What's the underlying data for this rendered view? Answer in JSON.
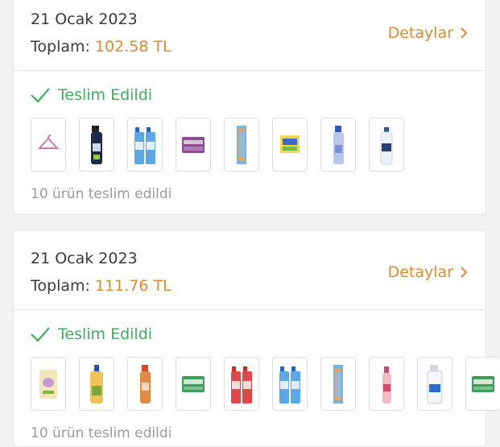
{
  "orders": [
    {
      "date": "21 Ocak 2023",
      "total_label": "Toplam:",
      "total_value": "102.58 TL",
      "details_label": "Detaylar",
      "status": "Teslim Edildi",
      "delivered_text": "10 ürün teslim edildi",
      "products": [
        "hanger-icon",
        "spray-dark-icon",
        "spray-double-blue-icon",
        "soap-pack-icon",
        "cloth-pack-icon",
        "sponge-pack-icon",
        "spray-lavender-icon",
        "bottle-white-icon"
      ]
    },
    {
      "date": "21 Ocak 2023",
      "total_label": "Toplam:",
      "total_value": "111.76 TL",
      "details_label": "Detaylar",
      "status": "Teslim Edildi",
      "delivered_text": "10 ürün teslim edildi",
      "products": [
        "wipes-pack-icon",
        "bottle-yellow-icon",
        "spray-orange-icon",
        "soap-green-icon",
        "spray-double-red-icon",
        "spray-double-blue-icon",
        "cloth-pack-icon",
        "spray-pink-icon",
        "spray-white-large-icon",
        "soap-green-icon"
      ]
    }
  ],
  "colors": {
    "accent": "#e38a2e",
    "success": "#3cb15a",
    "muted": "#9a9a9a"
  }
}
